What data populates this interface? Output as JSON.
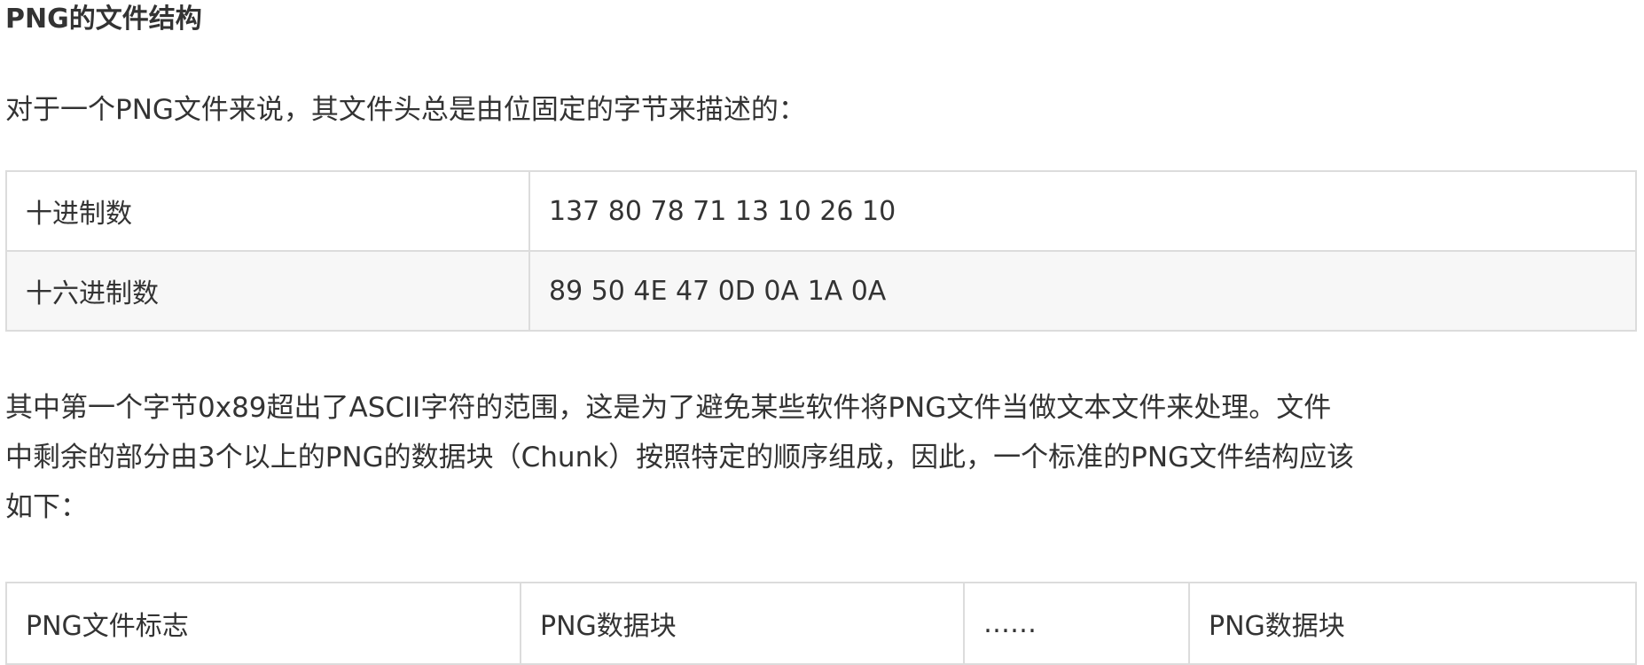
{
  "heading": "PNG的文件结构",
  "intro": "对于一个PNG文件来说，其文件头总是由位固定的字节来描述的：",
  "header_table": {
    "rows": [
      {
        "label": "十进制数",
        "value": "137 80 78 71 13 10 26 10"
      },
      {
        "label": "十六进制数",
        "value": "89 50 4E 47 0D 0A 1A 0A"
      }
    ]
  },
  "description": {
    "lines": [
      "其中第一个字节0x89超出了ASCII字符的范围，这是为了避免某些软件将PNG文件当做文本文件来处理。文件",
      "中剩余的部分由3个以上的PNG的数据块（Chunk）按照特定的顺序组成，因此，一个标准的PNG文件结构应该",
      "如下："
    ]
  },
  "structure_table": {
    "cells": [
      "PNG文件标志",
      "PNG数据块",
      "……",
      "PNG数据块"
    ]
  }
}
